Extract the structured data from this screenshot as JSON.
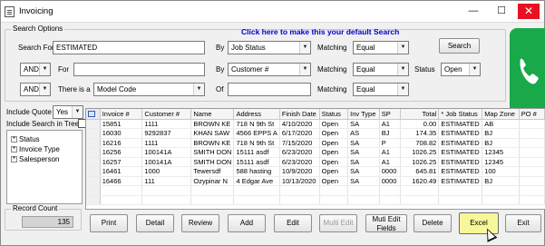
{
  "window": {
    "title": "Invoicing",
    "controls": {
      "minimize": "—",
      "maximize": "☐",
      "close": "✕"
    }
  },
  "search_options": {
    "legend": "Search Options",
    "default_link": "Click here to make this your default Search",
    "row1": {
      "label": "Search For",
      "value": "ESTIMATED",
      "by_label": "By",
      "by_value": "Job Status",
      "matching_label": "Matching",
      "matching_value": "Equal",
      "button": "Search"
    },
    "row2": {
      "conj": "AND",
      "label": "For",
      "value": "",
      "by_label": "By",
      "by_value": "Customer #",
      "matching_label": "Matching",
      "matching_value": "Equal",
      "status_label": "Status",
      "status_value": "Open"
    },
    "row3": {
      "conj": "AND",
      "label": "There is a",
      "value": "Model Code",
      "of_label": "Of",
      "of_value": "",
      "matching_label": "Matching",
      "matching_value": "Equal"
    }
  },
  "include_quote": {
    "label": "Include Quote",
    "value": "Yes"
  },
  "include_tree": {
    "label": "Include Search in Tree",
    "checked": false
  },
  "tree": {
    "items": [
      "Status",
      "Invoice Type",
      "Salesperson"
    ]
  },
  "grid": {
    "columns": [
      "Invoice #",
      "Customer #",
      "Name",
      "Address",
      "Finish Date",
      "Status",
      "Inv Type",
      "SP",
      "Total",
      "* Job Status",
      "Map Zone",
      "PO #"
    ],
    "rows": [
      [
        "15851",
        "1111",
        "BROWN KE",
        "718 N 9th St",
        "4/10/2020",
        "Open",
        "SA",
        "A1",
        "0.00",
        "ESTIMATED",
        "AB",
        ""
      ],
      [
        "16030",
        "9292837",
        "KHAN SAW",
        "4566 EPPS A",
        "6/17/2020",
        "Open",
        "AS",
        "BJ",
        "174.35",
        "ESTIMATED",
        "BJ",
        ""
      ],
      [
        "16216",
        "1111",
        "BROWN KE",
        "718 N 9th St",
        "7/15/2020",
        "Open",
        "SA",
        "P",
        "708.82",
        "ESTIMATED",
        "BJ",
        ""
      ],
      [
        "16256",
        "100141A",
        "SMITH DON",
        "15111 asdf",
        "6/23/2020",
        "Open",
        "SA",
        "A1",
        "1026.25",
        "ESTIMATED",
        "12345",
        ""
      ],
      [
        "16257",
        "100141A",
        "SMITH DON",
        "15111 asdf",
        "6/23/2020",
        "Open",
        "SA",
        "A1",
        "1026.25",
        "ESTIMATED",
        "12345",
        ""
      ],
      [
        "16461",
        "1000",
        "Tewersdf",
        "588 hasting",
        "10/9/2020",
        "Open",
        "SA",
        "0000",
        "645.81",
        "ESTIMATED",
        "100",
        ""
      ],
      [
        "16466",
        "111",
        "Ozypinar N",
        "4 Edgar Ave",
        "10/13/2020",
        "Open",
        "SA",
        "0000",
        "1620.49",
        "ESTIMATED",
        "BJ",
        ""
      ],
      [
        "",
        "",
        "",
        "",
        "",
        "",
        "",
        "",
        "",
        "",
        "",
        ""
      ],
      [
        "",
        "",
        "",
        "",
        "",
        "",
        "",
        "",
        "",
        "",
        "",
        ""
      ]
    ]
  },
  "record_count": {
    "legend": "Record Count",
    "value": "135"
  },
  "buttons": {
    "print": "Print",
    "detail": "Detail",
    "review": "Review",
    "add": "Add",
    "edit": "Edit",
    "multi_edit": "Multi Edit",
    "muti_edit_fields_1": "Muti Edit",
    "muti_edit_fields_2": "Fields",
    "delete": "Delete",
    "excel": "Excel",
    "exit": "Exit"
  },
  "colors": {
    "link": "#0000cc",
    "excel_highlight": "#f7f79a",
    "phone_green": "#19a84a",
    "close_red": "#e81123"
  }
}
